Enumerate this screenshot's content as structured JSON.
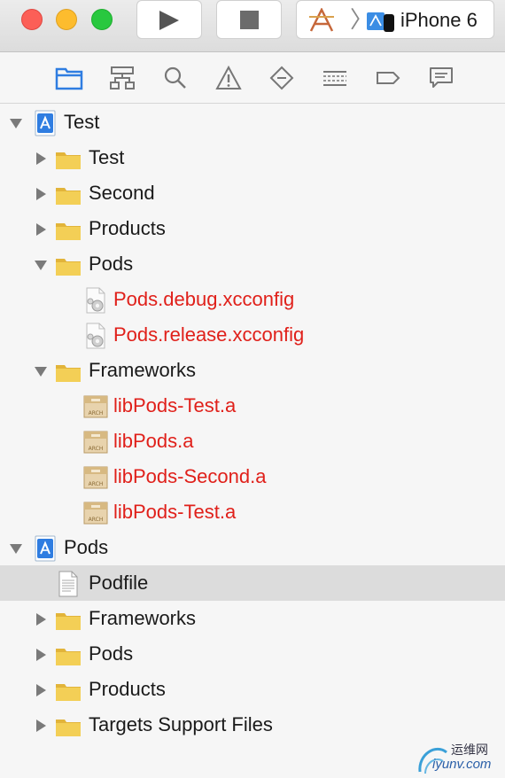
{
  "toolbar": {
    "run_icon": "play-icon",
    "stop_icon": "stop-icon",
    "scheme_separator": "〉",
    "device_label": "iPhone 6"
  },
  "navigator_tabs": [
    "folder-icon",
    "hierarchy-icon",
    "search-icon",
    "warning-icon",
    "test-diamond-icon",
    "debug-list-icon",
    "breakpoint-icon",
    "report-icon"
  ],
  "tree": [
    {
      "label": "Test",
      "kind": "project",
      "disclosure": "open",
      "color": "normal"
    },
    {
      "label": "Test",
      "kind": "folder",
      "disclosure": "closed",
      "color": "normal"
    },
    {
      "label": "Second",
      "kind": "folder",
      "disclosure": "closed",
      "color": "normal"
    },
    {
      "label": "Products",
      "kind": "folder",
      "disclosure": "closed",
      "color": "normal"
    },
    {
      "label": "Pods",
      "kind": "folder",
      "disclosure": "open",
      "color": "normal"
    },
    {
      "label": "Pods.debug.xcconfig",
      "kind": "config",
      "disclosure": "none",
      "color": "red"
    },
    {
      "label": "Pods.release.xcconfig",
      "kind": "config",
      "disclosure": "none",
      "color": "red"
    },
    {
      "label": "Frameworks",
      "kind": "folder",
      "disclosure": "open",
      "color": "normal"
    },
    {
      "label": "libPods-Test.a",
      "kind": "archive",
      "disclosure": "none",
      "color": "red"
    },
    {
      "label": "libPods.a",
      "kind": "archive",
      "disclosure": "none",
      "color": "red"
    },
    {
      "label": "libPods-Second.a",
      "kind": "archive",
      "disclosure": "none",
      "color": "red"
    },
    {
      "label": "libPods-Test.a",
      "kind": "archive",
      "disclosure": "none",
      "color": "red"
    },
    {
      "label": "Pods",
      "kind": "project",
      "disclosure": "open",
      "color": "normal"
    },
    {
      "label": "Podfile",
      "kind": "file",
      "disclosure": "none",
      "color": "normal",
      "selected": true
    },
    {
      "label": "Frameworks",
      "kind": "folder",
      "disclosure": "closed",
      "color": "normal"
    },
    {
      "label": "Pods",
      "kind": "folder",
      "disclosure": "closed",
      "color": "normal"
    },
    {
      "label": "Products",
      "kind": "folder",
      "disclosure": "closed",
      "color": "normal"
    },
    {
      "label": "Targets Support Files",
      "kind": "folder",
      "disclosure": "closed",
      "color": "normal"
    }
  ],
  "archive_badge": "ARCH",
  "watermark": {
    "line1": "运维网",
    "line2": "iyunv.com"
  },
  "colors": {
    "red_text": "#e0201a",
    "folder": "#f3cf56",
    "selection": "#dcdcdc",
    "project_blue": "#2f7de1"
  }
}
